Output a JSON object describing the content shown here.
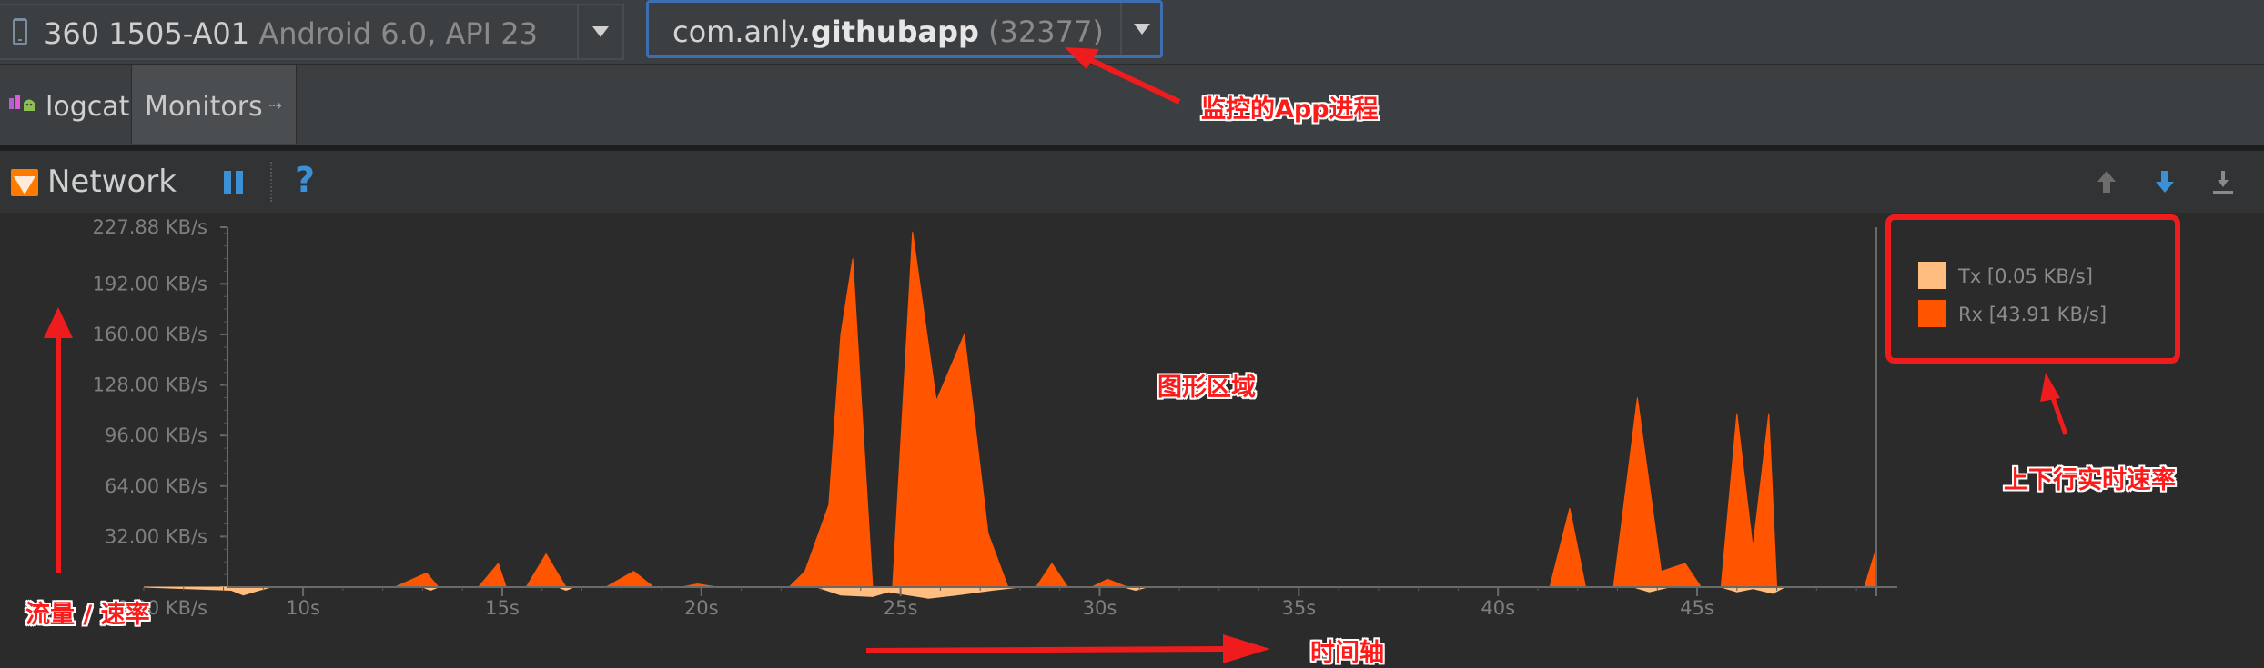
{
  "device": {
    "name": "360 1505-A01",
    "os": "Android 6.0, API 23"
  },
  "process": {
    "package_prefix": "com.anly.",
    "package_bold": "githubapp",
    "pid": "(32377)"
  },
  "tabs": [
    {
      "label": "logcat"
    },
    {
      "label": "Monitors"
    }
  ],
  "monitor": {
    "title": "Network",
    "help_label": "?"
  },
  "icons": {
    "device": "phone-icon",
    "dropdown": "chevron-down-icon",
    "logcat": "android-icon",
    "pin": "pin-icon",
    "network": "network-monitor-icon",
    "pause": "pause-icon",
    "help": "help-icon",
    "scroll_up": "arrow-up-icon",
    "scroll_down": "arrow-down-icon",
    "export": "export-icon"
  },
  "colors": {
    "tx": "#ffbd80",
    "rx": "#ff5500",
    "accent": "#3c90d6",
    "annotation": "#ff1a1a",
    "background": "#2b2b2b"
  },
  "chart_data": {
    "type": "area",
    "y_ticks": [
      "227.88 KB/s",
      "192.00 KB/s",
      "160.00 KB/s",
      "128.00 KB/s",
      "96.00 KB/s",
      "64.00 KB/s",
      "32.00 KB/s",
      "0.00 KB/s"
    ],
    "y_tick_values": [
      227.88,
      192,
      160,
      128,
      96,
      64,
      32,
      0
    ],
    "x_ticks": [
      "10s",
      "15s",
      "20s",
      "25s",
      "30s",
      "35s",
      "40s",
      "45s"
    ],
    "x_tick_values": [
      10,
      15,
      20,
      25,
      30,
      35,
      40,
      45
    ],
    "xlim": [
      6,
      49.5
    ],
    "ylim": [
      0,
      227.88
    ],
    "series": [
      {
        "name": "Rx",
        "points": [
          [
            6,
            0
          ],
          [
            12.3,
            0
          ],
          [
            13.1,
            9
          ],
          [
            13.4,
            0
          ],
          [
            14.4,
            0
          ],
          [
            14.9,
            15
          ],
          [
            15.1,
            0
          ],
          [
            15.6,
            0
          ],
          [
            16.1,
            21
          ],
          [
            16.6,
            0
          ],
          [
            17.6,
            0
          ],
          [
            18.3,
            10
          ],
          [
            18.8,
            0
          ],
          [
            19.5,
            0
          ],
          [
            19.9,
            2
          ],
          [
            20.4,
            0
          ],
          [
            22.2,
            0
          ],
          [
            22.6,
            10
          ],
          [
            23.2,
            52
          ],
          [
            23.5,
            160
          ],
          [
            23.8,
            208
          ],
          [
            24.3,
            0
          ],
          [
            24.8,
            0
          ],
          [
            25.3,
            225
          ],
          [
            25.9,
            118
          ],
          [
            26.6,
            160
          ],
          [
            27.2,
            34
          ],
          [
            27.7,
            0
          ],
          [
            28.4,
            0
          ],
          [
            28.8,
            15
          ],
          [
            29.2,
            0
          ],
          [
            29.8,
            0
          ],
          [
            30.2,
            5
          ],
          [
            30.7,
            0
          ],
          [
            41.3,
            0
          ],
          [
            41.8,
            50
          ],
          [
            42.2,
            0
          ],
          [
            42.9,
            0
          ],
          [
            43.5,
            120
          ],
          [
            44.1,
            10
          ],
          [
            44.7,
            15
          ],
          [
            45.1,
            0
          ],
          [
            45.6,
            0
          ],
          [
            46.0,
            110
          ],
          [
            46.4,
            25
          ],
          [
            46.8,
            110
          ],
          [
            47.0,
            0
          ],
          [
            49.2,
            0
          ],
          [
            49.5,
            25
          ],
          [
            49.5,
            0
          ]
        ]
      },
      {
        "name": "Tx",
        "points": [
          [
            6,
            0
          ],
          [
            8.2,
            -2
          ],
          [
            8.5,
            -5
          ],
          [
            8.9,
            -2
          ],
          [
            9.2,
            0
          ],
          [
            13.0,
            0
          ],
          [
            13.2,
            -2
          ],
          [
            13.4,
            0
          ],
          [
            16.4,
            0
          ],
          [
            16.6,
            -2
          ],
          [
            16.8,
            0
          ],
          [
            22.9,
            0
          ],
          [
            23.5,
            -5
          ],
          [
            24.3,
            -6
          ],
          [
            24.7,
            -3
          ],
          [
            25.2,
            -5
          ],
          [
            25.7,
            -7
          ],
          [
            26.4,
            -5
          ],
          [
            27.3,
            -2
          ],
          [
            28.0,
            0
          ],
          [
            30.6,
            0
          ],
          [
            30.9,
            -2
          ],
          [
            31.2,
            0
          ],
          [
            43.4,
            0
          ],
          [
            43.8,
            -3
          ],
          [
            44.3,
            0
          ],
          [
            45.6,
            0
          ],
          [
            46.0,
            -3
          ],
          [
            46.4,
            -1
          ],
          [
            46.9,
            -4
          ],
          [
            47.2,
            0
          ],
          [
            49.5,
            0
          ]
        ]
      }
    ],
    "legend": [
      {
        "series": "Tx",
        "text": "Tx [0.05 KB/s]"
      },
      {
        "series": "Rx",
        "text": "Rx [43.91 KB/s]"
      }
    ],
    "legend_position": "top-right"
  },
  "annotations": {
    "process": "监控的App进程",
    "chart_area": "图形区域",
    "realtime": "上下行实时速率",
    "rate": "流量 / 速率",
    "time_axis": "时间轴"
  }
}
